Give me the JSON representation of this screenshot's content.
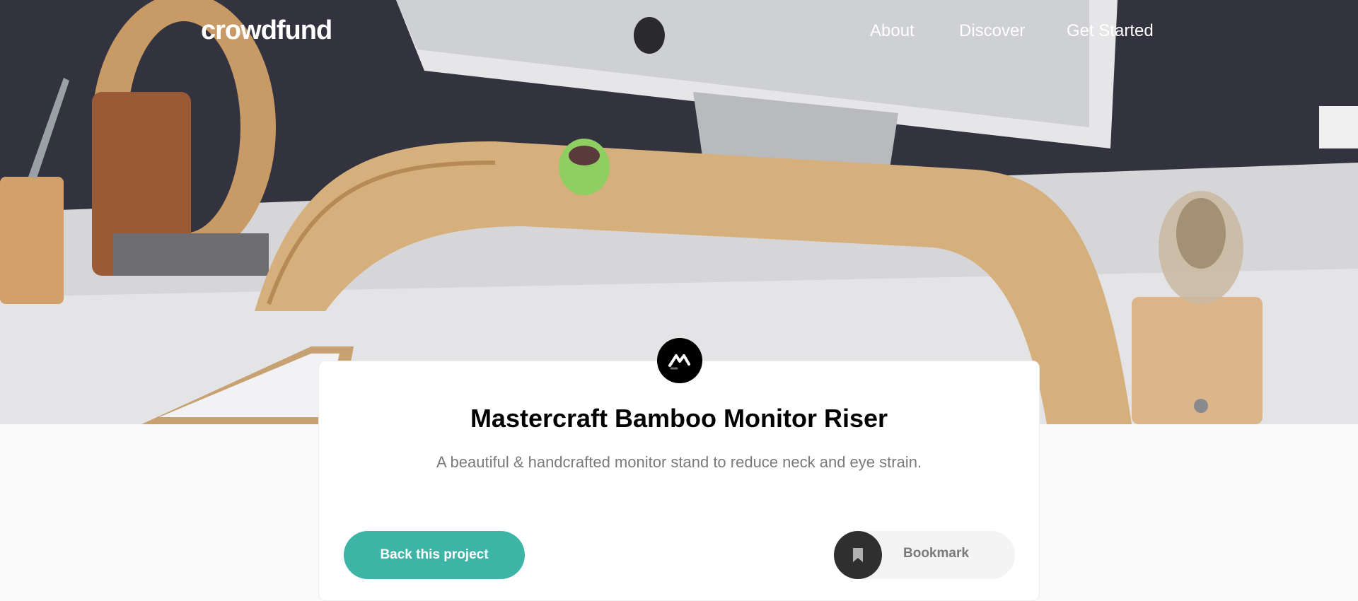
{
  "nav": {
    "logo": "crowdfund",
    "links": [
      "About",
      "Discover",
      "Get Started"
    ]
  },
  "project": {
    "logo_icon": "mastercraft-logo-icon",
    "title": "Mastercraft Bamboo Monitor Riser",
    "description": "A beautiful & handcrafted monitor stand to reduce neck and eye strain."
  },
  "actions": {
    "back_label": "Back this project",
    "bookmark_label": "Bookmark",
    "bookmark_icon": "bookmark-icon"
  },
  "colors": {
    "accent": "#3cb4a6",
    "dark": "#2f2f2f",
    "muted_text": "#7a7a7a",
    "page_bg": "#fafafa"
  }
}
